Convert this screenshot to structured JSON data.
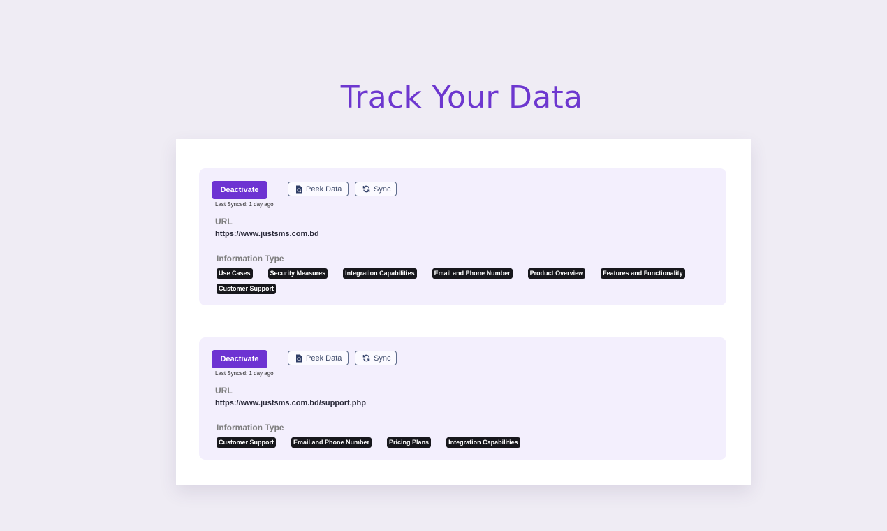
{
  "page": {
    "title": "Track Your Data"
  },
  "actions": {
    "deactivate_label": "Deactivate",
    "peek_label": "Peek Data",
    "sync_label": "Sync"
  },
  "labels": {
    "url": "URL",
    "information_type": "Information Type"
  },
  "icons": {
    "peek": "file-search-icon",
    "sync": "sync-icon"
  },
  "colors": {
    "accent": "#6d33d2",
    "title": "#6d37cf",
    "background": "#efecf4",
    "card_background": "#f3effd",
    "tag_background": "#17171c"
  },
  "sources": [
    {
      "last_synced": "Last Synced: 1 day ago",
      "url": "https://www.justsms.com.bd",
      "information_types": [
        "Use Cases",
        "Security Measures",
        "Integration Capabilities",
        "Email and Phone Number",
        "Product Overview",
        "Features and Functionality",
        "Customer Support"
      ]
    },
    {
      "last_synced": "Last Synced: 1 day ago",
      "url": "https://www.justsms.com.bd/support.php",
      "information_types": [
        "Customer Support",
        "Email and Phone Number",
        "Pricing Plans",
        "Integration Capabilities"
      ]
    }
  ]
}
